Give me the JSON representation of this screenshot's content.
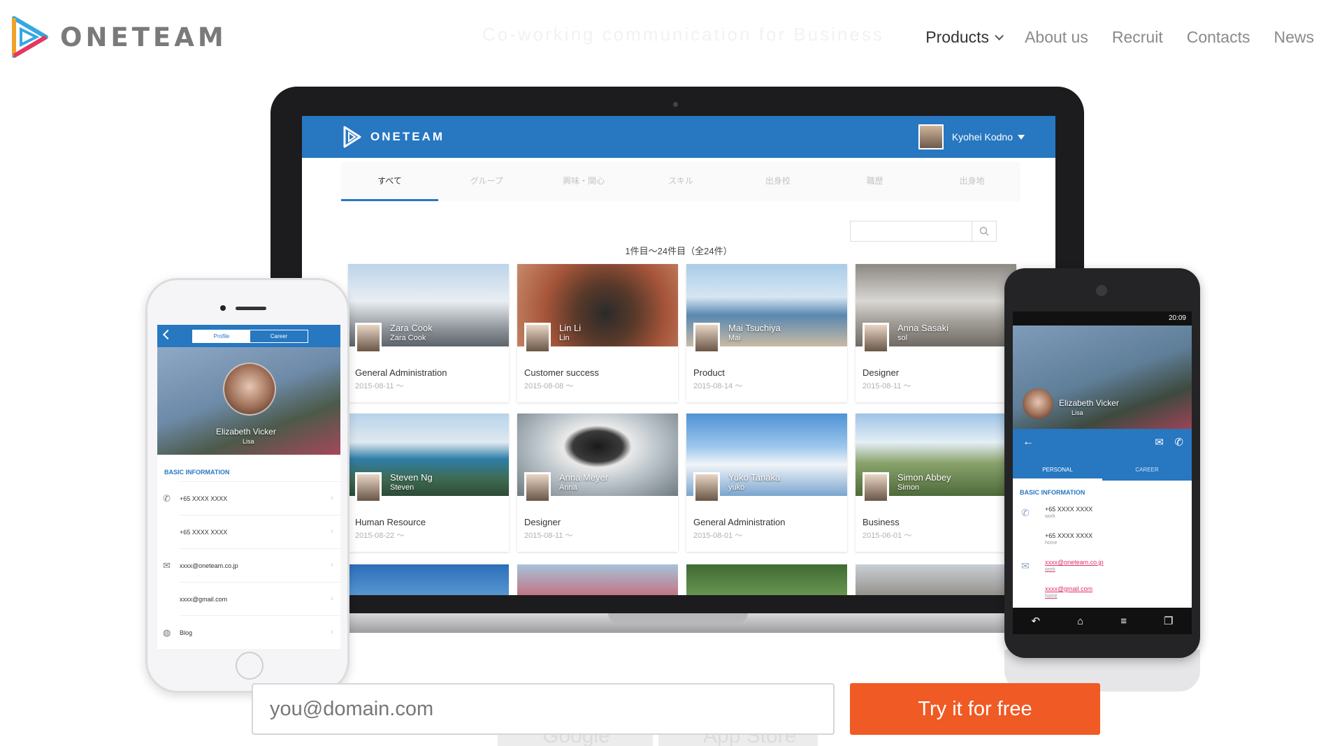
{
  "header": {
    "logo_text": "ONETEAM",
    "tagline": "Co-working communication for Business",
    "nav": [
      {
        "label": "Products"
      },
      {
        "label": "About us"
      },
      {
        "label": "Recruit"
      },
      {
        "label": "Contacts"
      },
      {
        "label": "News"
      }
    ]
  },
  "laptop_app": {
    "logo_text": "ONETEAM",
    "user_name": "Kyohei Kodno",
    "tabs": [
      "すべて",
      "グループ",
      "興味・関心",
      "スキル",
      "出身校",
      "職歴",
      "出身地"
    ],
    "result_count": "1件目〜24件目（全24件）",
    "cards": [
      {
        "name": "Zara Cook",
        "sub": "Zara Cook",
        "role": "General Administration",
        "date": "2015-08-11 〜"
      },
      {
        "name": "Lin Li",
        "sub": "Lin",
        "role": "Customer success",
        "date": "2015-08-08 〜"
      },
      {
        "name": "Mai Tsuchiya",
        "sub": "Mai",
        "role": "Product",
        "date": "2015-08-14 〜"
      },
      {
        "name": "Anna Sasaki",
        "sub": "sol",
        "role": "Designer",
        "date": "2015-08-11 〜"
      },
      {
        "name": "Steven Ng",
        "sub": "Steven",
        "role": "Human Resource",
        "date": "2015-08-22 〜"
      },
      {
        "name": "Anna Meyer",
        "sub": "Anna",
        "role": "Designer",
        "date": "2015-08-11 〜"
      },
      {
        "name": "Yuko Tanaka",
        "sub": "yuko",
        "role": "General Administration",
        "date": "2015-08-01 〜"
      },
      {
        "name": "Simon Abbey",
        "sub": "Simon",
        "role": "Business",
        "date": "2015-06-01 〜"
      }
    ]
  },
  "iphone_app": {
    "segments": [
      "Profile",
      "Career"
    ],
    "profile_name": "Elizabeth Vicker",
    "profile_sub": "Lisa",
    "section_title": "BASIC INFORMATION",
    "rows": [
      {
        "icon": "phone-icon",
        "value": "+65 XXXX XXXX"
      },
      {
        "icon": "",
        "value": "+65 XXXX XXXX"
      },
      {
        "icon": "mail-icon",
        "value": "xxxx@oneteam.co.jp"
      },
      {
        "icon": "",
        "value": "xxxx@gmail.com"
      },
      {
        "icon": "globe-icon",
        "value": "Blog"
      }
    ]
  },
  "android_app": {
    "status_time": "20:09",
    "profile_name": "Elizabeth Vicker",
    "profile_sub": "Lisa",
    "tabs": [
      "PERSONAL",
      "CAREER"
    ],
    "section_title": "BASIC INFORMATION",
    "rows": [
      {
        "value": "+65 XXXX XXXX",
        "label": "work"
      },
      {
        "value": "+65 XXXX XXXX",
        "label": "home"
      },
      {
        "value": "xxxx@oneteam.co.jp",
        "label": "work"
      },
      {
        "value": "xxxx@gmail.com",
        "label": "home"
      }
    ]
  },
  "cta": {
    "email_placeholder": "you@domain.com",
    "button_label": "Try it for free",
    "store_google": "Google Play",
    "store_apple": "App Store"
  },
  "colors": {
    "brand_blue": "#2777c1",
    "cta_orange": "#f05a24"
  }
}
